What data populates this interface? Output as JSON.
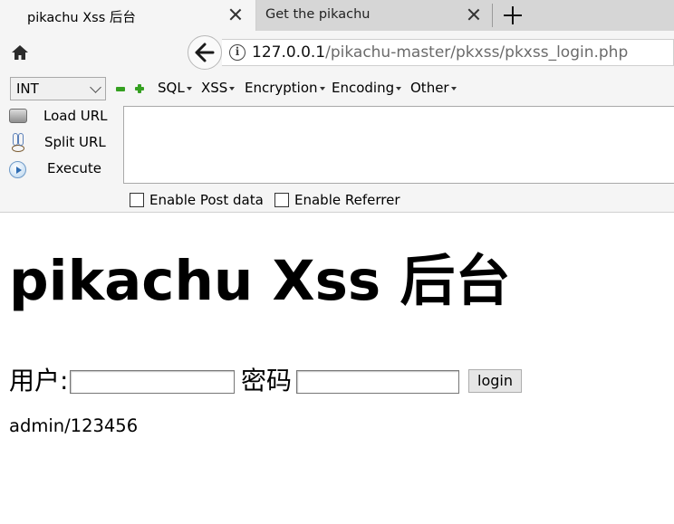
{
  "browser": {
    "tabs": [
      {
        "title": "pikachu Xss 后台",
        "active": true
      },
      {
        "title": "Get the pikachu",
        "active": false
      }
    ],
    "url": {
      "host": "127.0.0.1",
      "path": "/pikachu-master/pkxss/pkxss_login.php"
    }
  },
  "hackbar": {
    "select_value": "INT",
    "menus": [
      "SQL",
      "XSS",
      "Encryption",
      "Encoding",
      "Other"
    ],
    "actions": [
      "Load URL",
      "Split URL",
      "Execute"
    ],
    "textarea_value": "",
    "checkboxes": [
      {
        "label": "Enable Post data",
        "checked": false
      },
      {
        "label": "Enable Referrer",
        "checked": false
      }
    ]
  },
  "page": {
    "title": "pikachu Xss 后台",
    "username_label": "用户:",
    "username_value": "",
    "password_label": "密码",
    "password_value": "",
    "login_button": "login",
    "hint": "admin/123456"
  },
  "colors": {
    "tabstrip": "#d6d6d6",
    "toolbar": "#f5f5f5",
    "hackbar_green": "#35a021"
  }
}
